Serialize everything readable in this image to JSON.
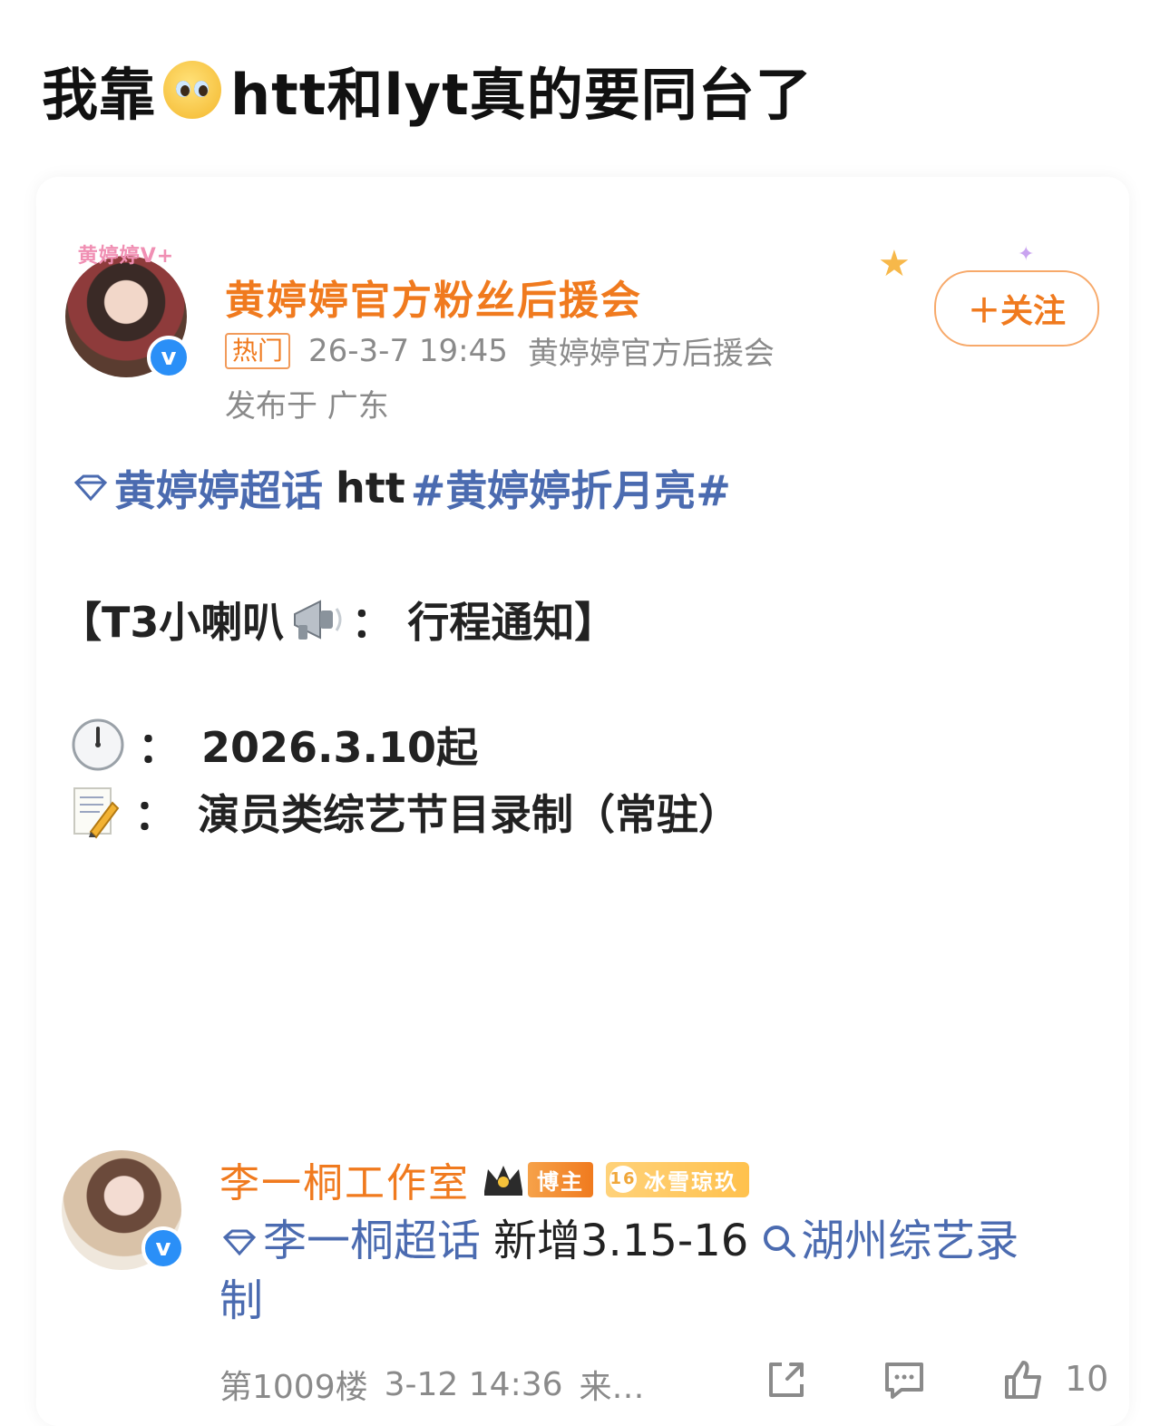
{
  "headline": {
    "prefix": "我靠",
    "emoji": "pleading-face",
    "suffix": "htt和lyt真的要同台了"
  },
  "post": {
    "author_name": "黄婷婷官方粉丝后援会",
    "avatar_frame_text": "黄婷婷V+",
    "verified_mark": "v",
    "hot_tag": "热门",
    "timestamp": "26-3-7 19:45",
    "source": "黄婷婷官方后援会",
    "location": "发布于 广东",
    "follow_label": "＋关注",
    "topic_link": "黄婷婷超话",
    "topic_plain": "htt",
    "hashtag": "#黄婷婷折月亮#",
    "section_open": "【T3小喇叭",
    "section_close": "： 行程通知】",
    "date_colon": "：",
    "date_value": "2026.3.10起",
    "content_colon": "：",
    "content_value": "演员类综艺节目录制（常驻）"
  },
  "comment": {
    "author_name": "李一桐工作室",
    "badge_blogger": "博主",
    "badge_level_num": "16",
    "badge_level_name": "冰雪琼玖",
    "verified_mark": "v",
    "topic_link": "李一桐超话",
    "text_plain": "新增3.15-16",
    "search_link_line1": "湖州综艺录",
    "search_link_line2": "制",
    "floor": "第1009楼",
    "time": "3-12 14:36",
    "source_truncated": "来…",
    "like_count": "10"
  },
  "colors": {
    "accent_orange": "#f07a1e",
    "link_blue": "#4b6bb0",
    "meta_gray": "#8a8a8a",
    "verified_blue": "#2a8ff7"
  }
}
